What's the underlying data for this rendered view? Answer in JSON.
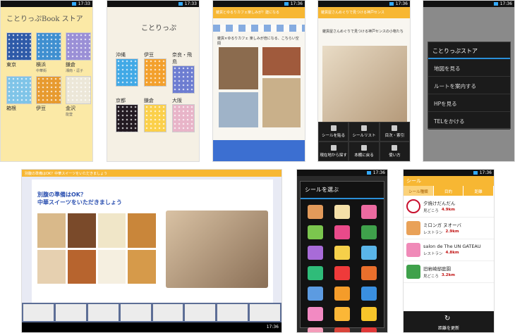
{
  "status_time": "17:33",
  "status_time_b": "17:36",
  "store": {
    "title": "ことりっぷBook ストア",
    "books": [
      {
        "label": "東京",
        "sub": "",
        "color": "#2e5aa8"
      },
      {
        "label": "横浜",
        "sub": "中華街",
        "color": "#3f8fd0"
      },
      {
        "label": "鎌倉",
        "sub": "湘南・逗子",
        "color": "#9a8fd6"
      },
      {
        "label": "箱根",
        "sub": "",
        "color": "#7fc4e8"
      },
      {
        "label": "伊豆",
        "sub": "",
        "color": "#e79a2f"
      },
      {
        "label": "金沢",
        "sub": "能登",
        "color": "#ece7d8"
      }
    ]
  },
  "shelf": {
    "title": "ことりっぷ",
    "books": [
      {
        "label": "沖縄",
        "color": "#41a9e6"
      },
      {
        "label": "伊豆",
        "color": "#f3a02c"
      },
      {
        "label": "奈良・飛鳥",
        "color": "#6d7dd1"
      },
      {
        "label": "京都",
        "color": "#231a22"
      },
      {
        "label": "鎌倉",
        "color": "#fbd04a"
      },
      {
        "label": "大阪",
        "color": "#e8b4c8"
      }
    ]
  },
  "article1": {
    "header": "雑貨とゆるりカフェ楽しみが？建になる",
    "title": "雑貨×ゆるりカフェ 楽しみが倍になる、こちらい空間"
  },
  "article2": {
    "header": "雑貨屋さんめぐりで見つける神戸センス",
    "title": "雑貨屋さんめぐりで見つける神戸センスの小物たち",
    "toolbar": [
      "シールを貼る",
      "シールリスト",
      "目次・索引",
      "現在地から探す",
      "本棚に戻る",
      "使い方"
    ]
  },
  "context_menu": {
    "title": "ことりっぷストア",
    "items": [
      "地図を見る",
      "ルートを案内する",
      "HPを見る",
      "TELをかける"
    ]
  },
  "tablet": {
    "header": "別腹の準備はOK？中華スイーツをいただきましょう",
    "title_line1": "別腹の準備はOK？",
    "title_line2": "中華スイーツをいただきましょう",
    "time": "17:36"
  },
  "stamps": {
    "title": "シールを選ぶ",
    "colors": [
      "#e29a5a",
      "#f4e0a8",
      "#ec6aa0",
      "#7bc64e",
      "#e94a8a",
      "#3fa14b",
      "#a86bd8",
      "#f5d04a",
      "#5ab5e8",
      "#2fbc79",
      "#ef3a3a",
      "#e96f2c",
      "#5c9be1",
      "#f49c2a",
      "#3a8fe0",
      "#f28ac2",
      "#fbb737",
      "#f7c52a",
      "#f49cba",
      "#d8443a",
      "#e03838"
    ]
  },
  "seal_list": {
    "header": "シール",
    "tabs": [
      "シール種類",
      "目的",
      "距離"
    ],
    "items": [
      {
        "name": "夕焼けだんだん",
        "cat": "見どころ",
        "dist": "4.9km",
        "color": "#c8102e"
      },
      {
        "name": "ミロンガ ヌオーバ",
        "cat": "レストラン",
        "dist": "2.9km",
        "color": "#e9a158"
      },
      {
        "name": "salon de The UN GATEAU",
        "cat": "レストラン",
        "dist": "4.8km",
        "color": "#f08ab8"
      },
      {
        "name": "旧岩崎邸庭園",
        "cat": "見どころ",
        "dist": "3.2km",
        "color": "#3fa14b"
      }
    ],
    "refresh": "距離を更新"
  }
}
